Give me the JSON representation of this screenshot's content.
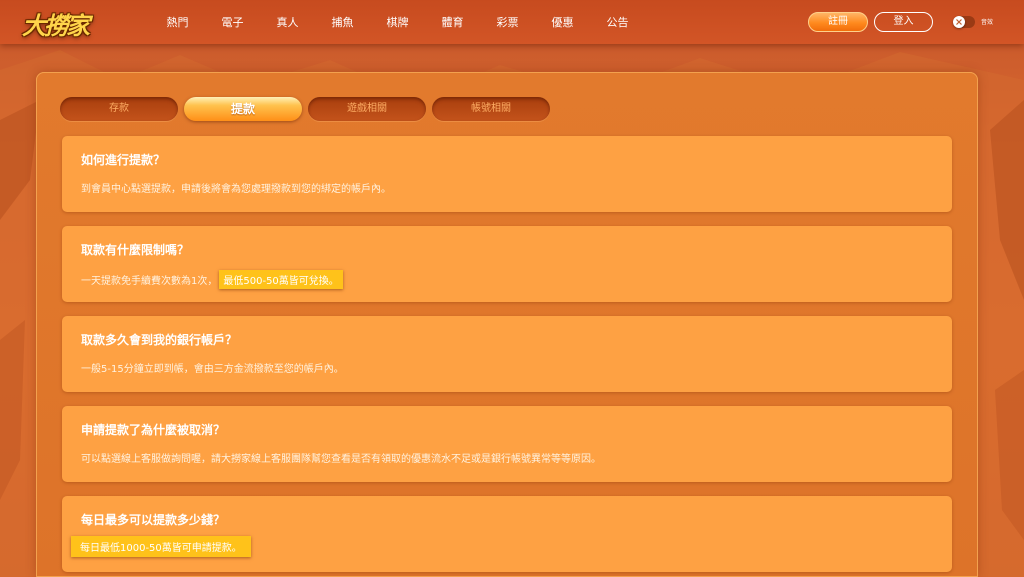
{
  "header": {
    "logo_text": "大撈家",
    "nav": [
      "熱門",
      "電子",
      "真人",
      "捕魚",
      "棋牌",
      "體育",
      "彩票",
      "優惠",
      "公告"
    ],
    "register_label": "註冊",
    "login_label": "登入",
    "sound_label": "音效"
  },
  "tabs": [
    {
      "label": "存款",
      "active": false
    },
    {
      "label": "提款",
      "active": true
    },
    {
      "label": "遊戲相關",
      "active": false
    },
    {
      "label": "帳號相關",
      "active": false
    }
  ],
  "faq": [
    {
      "question": "如何進行提款？",
      "answer": "到會員中心點選提款，申請後將會為您處理撥款到您的綁定的帳戶內。",
      "highlight": ""
    },
    {
      "question": "取款有什麼限制嗎？",
      "answer": "一天提款免手續費次數為1次，",
      "highlight": "最低500-50萬皆可兌換。"
    },
    {
      "question": "取款多久會到我的銀行帳戶？",
      "answer": "一般5-15分鐘立即到帳，會由三方金流撥款至您的帳戶內。",
      "highlight": ""
    },
    {
      "question": "申請提款了為什麼被取消？",
      "answer": "可以點選線上客服做詢問喔，請大撈家線上客服團隊幫您查看是否有領取的優惠流水不足或是銀行帳號異常等等原因。",
      "highlight": ""
    },
    {
      "question": "每日最多可以提款多少錢？",
      "answer": "",
      "highlight": "每日最低1000-50萬皆可申請提款。"
    }
  ],
  "colors": {
    "accent": "#ff8f17",
    "card": "#fea143",
    "highlight": "#ffc21a",
    "topbar": "#c74b1f"
  }
}
